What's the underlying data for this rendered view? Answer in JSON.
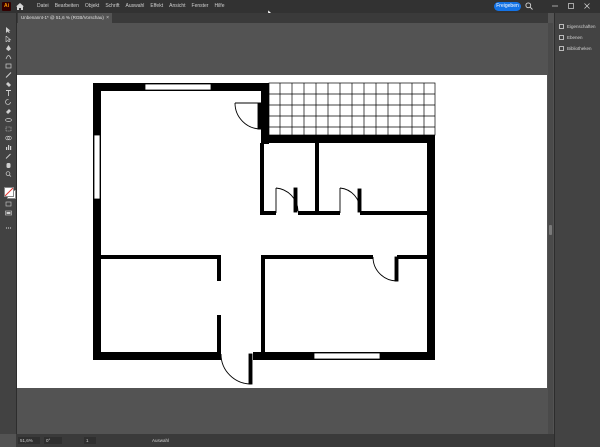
{
  "app": {
    "logo_text": "Ai"
  },
  "menu": {
    "items": [
      "Datei",
      "Bearbeiten",
      "Objekt",
      "Schrift",
      "Auswahl",
      "Effekt",
      "Ansicht",
      "Fenster",
      "Hilfe"
    ]
  },
  "header": {
    "share_label": "Freigeben"
  },
  "document": {
    "tab_title": "Unbenannt-1* @ 51,6 % (RGB/Vorschau)",
    "close_glyph": "×"
  },
  "right_panel": {
    "items": [
      {
        "label": "Eigenschaften",
        "icon": "properties-icon"
      },
      {
        "label": "Ebenen",
        "icon": "layers-icon"
      },
      {
        "label": "Bibliotheken",
        "icon": "libraries-icon"
      }
    ]
  },
  "status": {
    "zoom": "51,6%",
    "rotation": "0°",
    "artboard_number": "1",
    "tool_name": "Auswahl"
  },
  "colors": {
    "menubar": "#323232",
    "canvas": "#535353",
    "accent": "#1473e6",
    "wall": "#000000",
    "artboard": "#ffffff"
  }
}
